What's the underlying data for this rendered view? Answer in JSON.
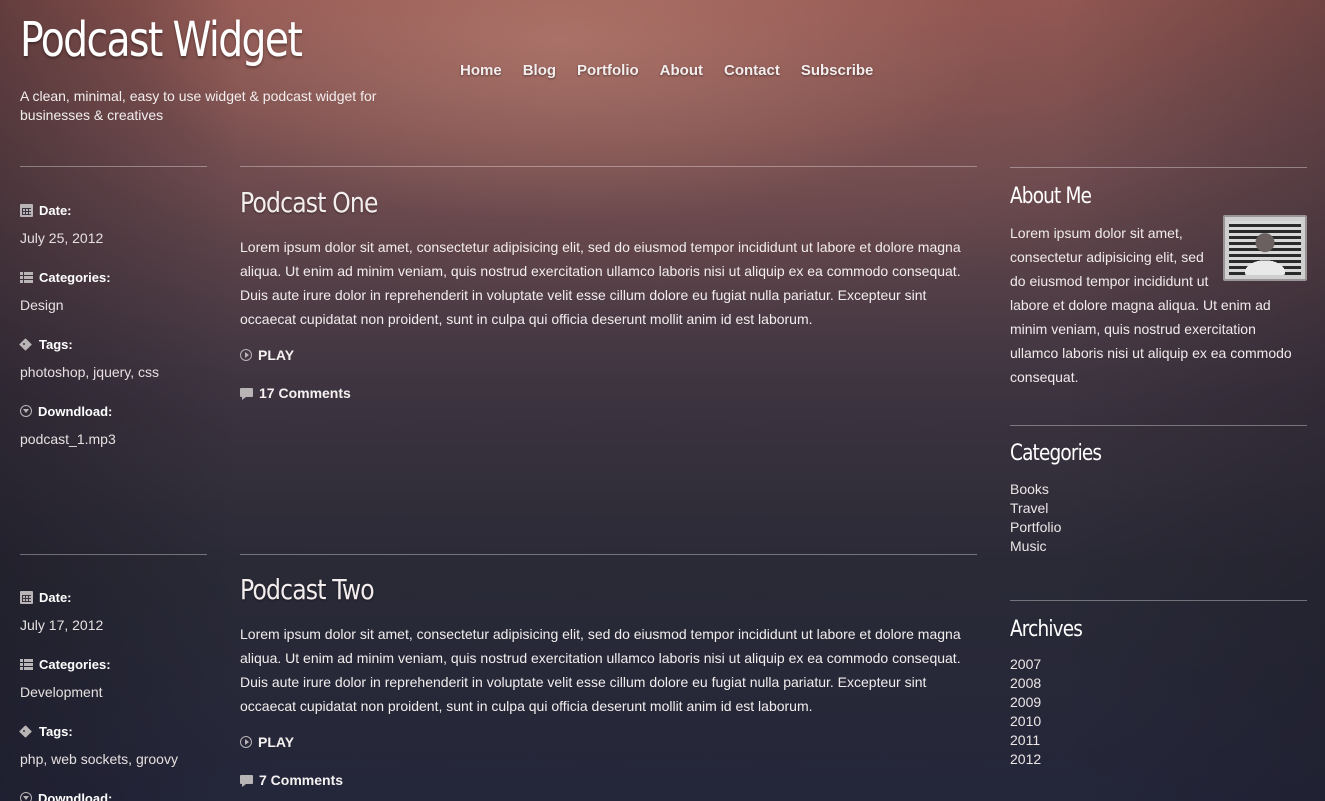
{
  "header": {
    "title": "Podcast Widget",
    "tagline": "A clean, minimal, easy to use widget & podcast widget for businesses & creatives"
  },
  "nav": {
    "items": [
      {
        "label": "Home"
      },
      {
        "label": "Blog"
      },
      {
        "label": "Portfolio"
      },
      {
        "label": "About"
      },
      {
        "label": "Contact"
      },
      {
        "label": "Subscribe"
      }
    ]
  },
  "posts": [
    {
      "title": "Podcast One",
      "body": "Lorem ipsum dolor sit amet, consectetur adipisicing elit, sed do eiusmod tempor incididunt ut labore et dolore magna aliqua. Ut enim ad minim veniam, quis nostrud exercitation ullamco laboris nisi ut aliquip ex ea commodo consequat. Duis aute irure dolor in reprehenderit in voluptate velit esse cillum dolore eu fugiat nulla pariatur. Excepteur sint occaecat cupidatat non proident, sunt in culpa qui officia deserunt mollit anim id est laborum.",
      "play_label": "PLAY",
      "comments_label": "17 Comments",
      "meta": {
        "date_label": "Date:",
        "date": "July 25, 2012",
        "categories_label": "Categories:",
        "categories": "Design",
        "tags_label": "Tags:",
        "tags": "photoshop, jquery, css",
        "download_label": "Downdload:",
        "download": "podcast_1.mp3"
      }
    },
    {
      "title": "Podcast Two",
      "body": "Lorem ipsum dolor sit amet, consectetur adipisicing elit, sed do eiusmod tempor incididunt ut labore et dolore magna aliqua. Ut enim ad minim veniam, quis nostrud exercitation ullamco laboris nisi ut aliquip ex ea commodo consequat. Duis aute irure dolor in reprehenderit in voluptate velit esse cillum dolore eu fugiat nulla pariatur. Excepteur sint occaecat cupidatat non proident, sunt in culpa qui officia deserunt mollit anim id est laborum.",
      "play_label": "PLAY",
      "comments_label": "7 Comments",
      "meta": {
        "date_label": "Date:",
        "date": "July 17, 2012",
        "categories_label": "Categories:",
        "categories": "Development",
        "tags_label": "Tags:",
        "tags": "php, web sockets, groovy",
        "download_label": "Downdload:"
      }
    }
  ],
  "sidebar": {
    "about": {
      "title": "About Me",
      "text": "Lorem ipsum dolor sit amet, consectetur adipisicing elit, sed do eiusmod tempor incididunt ut labore et dolore magna aliqua. Ut enim ad minim veniam, quis nostrud exercitation ullamco laboris nisi ut aliquip ex ea commodo consequat."
    },
    "categories": {
      "title": "Categories",
      "items": [
        "Books",
        "Travel",
        "Portfolio",
        "Music"
      ]
    },
    "archives": {
      "title": "Archives",
      "items": [
        "2007",
        "2008",
        "2009",
        "2010",
        "2011",
        "2012"
      ]
    }
  }
}
